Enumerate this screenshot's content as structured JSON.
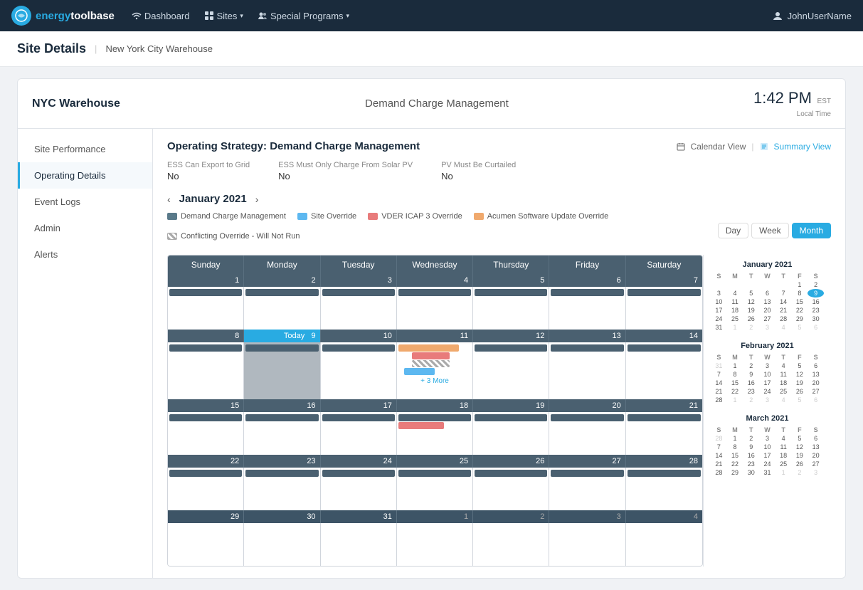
{
  "topNav": {
    "logoText1": "energy",
    "logoText2": "toolbase",
    "navItems": [
      {
        "id": "dashboard",
        "icon": "wifi-icon",
        "label": "Dashboard",
        "hasDropdown": false
      },
      {
        "id": "sites",
        "icon": "grid-icon",
        "label": "Sites",
        "hasDropdown": true
      },
      {
        "id": "special-programs",
        "icon": "people-icon",
        "label": "Special Programs",
        "hasDropdown": true
      }
    ],
    "userName": "JohnUserName"
  },
  "breadcrumb": {
    "title": "Site Details",
    "sub": "New York City Warehouse"
  },
  "cardHeader": {
    "siteName": "NYC Warehouse",
    "pageTitle": "Demand Charge Management",
    "time": "1:42 PM",
    "timezone": "EST",
    "localTime": "Local Time"
  },
  "sidebar": {
    "items": [
      {
        "id": "site-performance",
        "label": "Site Performance",
        "active": false
      },
      {
        "id": "operating-details",
        "label": "Operating Details",
        "active": true
      },
      {
        "id": "event-logs",
        "label": "Event Logs",
        "active": false
      },
      {
        "id": "admin",
        "label": "Admin",
        "active": false
      },
      {
        "id": "alerts",
        "label": "Alerts",
        "active": false
      }
    ]
  },
  "operatingStrategy": {
    "title": "Operating Strategy: Demand Charge Management",
    "details": [
      {
        "id": "ess-export",
        "label": "ESS Can Export to Grid",
        "value": "No"
      },
      {
        "id": "ess-charge",
        "label": "ESS Must Only Charge From Solar PV",
        "value": "No"
      },
      {
        "id": "pv-curtailed",
        "label": "PV Must Be Curtailed",
        "value": "No"
      }
    ],
    "views": {
      "calendarView": "Calendar View",
      "summaryView": "Summary View"
    }
  },
  "calendar": {
    "month": "January 2021",
    "year": 2021,
    "monthNum": 1,
    "legend": [
      {
        "id": "dcm",
        "label": "Demand Charge Management",
        "type": "dcm"
      },
      {
        "id": "site-override",
        "label": "Site Override",
        "type": "site"
      },
      {
        "id": "vder",
        "label": "VDER ICAP 3 Override",
        "type": "vder"
      },
      {
        "id": "acumen",
        "label": "Acumen Software Update Override",
        "type": "acumen"
      },
      {
        "id": "conflicting",
        "label": "Conflicting Override - Will Not Run",
        "type": "conflicting"
      }
    ],
    "viewButtons": [
      {
        "id": "day",
        "label": "Day"
      },
      {
        "id": "week",
        "label": "Week"
      },
      {
        "id": "month",
        "label": "Month",
        "active": true
      }
    ],
    "dayHeaders": [
      "Sunday",
      "Monday",
      "Tuesday",
      "Wednesday",
      "Thursday",
      "Friday",
      "Saturday"
    ],
    "weeks": [
      {
        "dateRow": [
          {
            "num": 1,
            "otherMonth": false,
            "today": false
          },
          {
            "num": 2,
            "otherMonth": false,
            "today": false
          },
          {
            "num": 3,
            "otherMonth": false,
            "today": false
          },
          {
            "num": 4,
            "otherMonth": false,
            "today": false
          },
          {
            "num": 5,
            "otherMonth": false,
            "today": false
          },
          {
            "num": 6,
            "otherMonth": false,
            "today": false
          },
          {
            "num": 7,
            "otherMonth": false,
            "today": false
          }
        ],
        "events": [
          {
            "col": 0,
            "type": "dcm"
          },
          {
            "col": 1,
            "type": "dcm"
          },
          {
            "col": 2,
            "type": "dcm"
          },
          {
            "col": 3,
            "type": "dcm"
          },
          {
            "col": 4,
            "type": "dcm"
          },
          {
            "col": 5,
            "type": "dcm"
          },
          {
            "col": 6,
            "type": "dcm"
          }
        ]
      },
      {
        "dateRow": [
          {
            "num": 8,
            "otherMonth": false,
            "today": false
          },
          {
            "num": 9,
            "otherMonth": false,
            "today": true
          },
          {
            "num": 10,
            "otherMonth": false,
            "today": false
          },
          {
            "num": 11,
            "otherMonth": false,
            "today": false
          },
          {
            "num": 12,
            "otherMonth": false,
            "today": false
          },
          {
            "num": 13,
            "otherMonth": false,
            "today": false
          },
          {
            "num": 14,
            "otherMonth": false,
            "today": false
          }
        ],
        "events": [
          {
            "col": 0,
            "type": "dcm"
          },
          {
            "col": 1,
            "type": "dcm"
          },
          {
            "col": 2,
            "type": "dcm"
          },
          {
            "col": 3,
            "type": "acumen"
          },
          {
            "col": 4,
            "type": "dcm"
          },
          {
            "col": 5,
            "type": "dcm"
          },
          {
            "col": 6,
            "type": "dcm"
          }
        ],
        "extra": {
          "col3vder": true,
          "col3conflicting": true,
          "col3site": true,
          "moreLink": "+ 3 More"
        }
      },
      {
        "dateRow": [
          {
            "num": 15,
            "otherMonth": false,
            "today": false
          },
          {
            "num": 16,
            "otherMonth": false,
            "today": false
          },
          {
            "num": 17,
            "otherMonth": false,
            "today": false
          },
          {
            "num": 18,
            "otherMonth": false,
            "today": false
          },
          {
            "num": 19,
            "otherMonth": false,
            "today": false
          },
          {
            "num": 20,
            "otherMonth": false,
            "today": false
          },
          {
            "num": 21,
            "otherMonth": false,
            "today": false
          }
        ],
        "events": [
          {
            "col": 0,
            "type": "dcm"
          },
          {
            "col": 1,
            "type": "dcm"
          },
          {
            "col": 2,
            "type": "dcm"
          },
          {
            "col": 3,
            "type": "dcm"
          },
          {
            "col": 4,
            "type": "dcm"
          },
          {
            "col": 5,
            "type": "dcm"
          },
          {
            "col": 6,
            "type": "dcm"
          }
        ],
        "extra18": true
      },
      {
        "dateRow": [
          {
            "num": 22,
            "otherMonth": false,
            "today": false
          },
          {
            "num": 23,
            "otherMonth": false,
            "today": false
          },
          {
            "num": 24,
            "otherMonth": false,
            "today": false
          },
          {
            "num": 25,
            "otherMonth": false,
            "today": false
          },
          {
            "num": 26,
            "otherMonth": false,
            "today": false
          },
          {
            "num": 27,
            "otherMonth": false,
            "today": false
          },
          {
            "num": 28,
            "otherMonth": false,
            "today": false
          }
        ],
        "events": [
          {
            "col": 0,
            "type": "dcm"
          },
          {
            "col": 1,
            "type": "dcm"
          },
          {
            "col": 2,
            "type": "dcm"
          },
          {
            "col": 3,
            "type": "dcm"
          },
          {
            "col": 4,
            "type": "dcm"
          },
          {
            "col": 5,
            "type": "dcm"
          },
          {
            "col": 6,
            "type": "dcm"
          }
        ]
      }
    ],
    "miniCals": [
      {
        "id": "jan-mini",
        "title": "January 2021",
        "weeks": [
          [
            "",
            "",
            "",
            "",
            "",
            "1",
            "2"
          ],
          [
            "3",
            "4",
            "5",
            "6",
            "7",
            "8",
            "9"
          ],
          [
            "10",
            "11",
            "12",
            "13",
            "14",
            "15",
            "16"
          ],
          [
            "17",
            "18",
            "19",
            "20",
            "21",
            "22",
            "23"
          ],
          [
            "24",
            "25",
            "26",
            "27",
            "28",
            "29",
            "30"
          ],
          [
            "31",
            "",
            "",
            "",
            "",
            "",
            ""
          ]
        ]
      },
      {
        "id": "feb-mini",
        "title": "February 2021",
        "weeks": [
          [
            "",
            "1",
            "2",
            "3",
            "4",
            "5",
            "6"
          ],
          [
            "7",
            "8",
            "9",
            "10",
            "11",
            "12",
            "13"
          ],
          [
            "14",
            "15",
            "16",
            "17",
            "18",
            "19",
            "20"
          ],
          [
            "21",
            "22",
            "23",
            "24",
            "25",
            "26",
            "27"
          ],
          [
            "28",
            "",
            "",
            "",
            "",
            "",
            ""
          ]
        ]
      },
      {
        "id": "mar-mini",
        "title": "March 2021",
        "weeks": [
          [
            "",
            "1",
            "2",
            "3",
            "4",
            "5",
            "6"
          ],
          [
            "7",
            "8",
            "9",
            "10",
            "11",
            "12",
            "13"
          ],
          [
            "14",
            "15",
            "16",
            "17",
            "18",
            "19",
            "20"
          ],
          [
            "21",
            "22",
            "23",
            "24",
            "25",
            "26",
            "27"
          ],
          [
            "28",
            "29",
            "30",
            "31",
            "",
            "",
            ""
          ]
        ]
      }
    ]
  }
}
